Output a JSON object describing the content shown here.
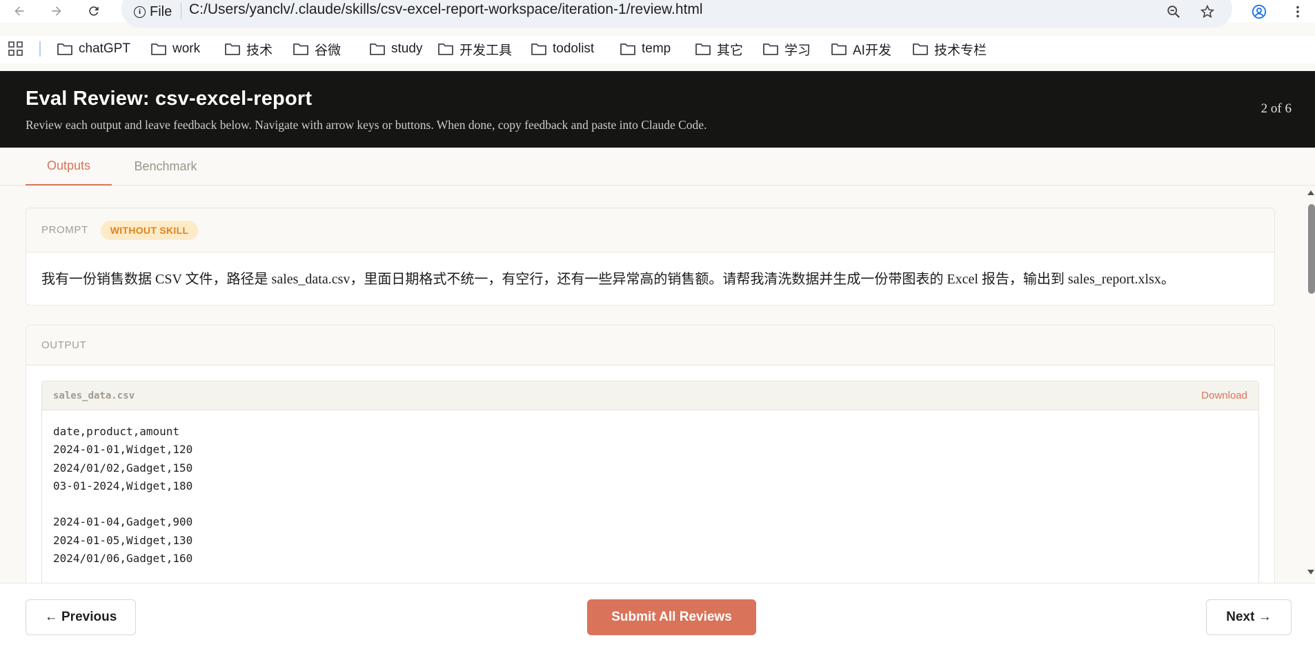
{
  "browser": {
    "file_label": "File",
    "url": "C:/Users/yanclv/.claude/skills/csv-excel-report-workspace/iteration-1/review.html",
    "bookmarks": [
      "chatGPT",
      "work",
      "技术",
      "谷微",
      "study",
      "开发工具",
      "todolist",
      "temp",
      "其它",
      "学习",
      "AI开发",
      "技术专栏"
    ]
  },
  "header": {
    "title": "Eval Review: csv-excel-report",
    "subtitle": "Review each output and leave feedback below. Navigate with arrow keys or buttons. When done, copy feedback and paste into Claude Code.",
    "counter": "2 of 6"
  },
  "tabs": [
    {
      "label": "Outputs",
      "active": true
    },
    {
      "label": "Benchmark",
      "active": false
    }
  ],
  "prompt": {
    "label": "PROMPT",
    "badge": "WITHOUT SKILL",
    "text": "我有一份销售数据 CSV 文件，路径是 sales_data.csv，里面日期格式不统一，有空行，还有一些异常高的销售额。请帮我清洗数据并生成一份带图表的 Excel 报告，输出到 sales_report.xlsx。"
  },
  "output": {
    "label": "OUTPUT",
    "file_name": "sales_data.csv",
    "download_label": "Download",
    "content": "date,product,amount\n2024-01-01,Widget,120\n2024/01/02,Gadget,150\n03-01-2024,Widget,180\n\n2024-01-04,Gadget,900\n2024-01-05,Widget,130\n2024/01/06,Gadget,160\n\n"
  },
  "footer": {
    "previous_label": "← Previous",
    "submit_label": "Submit All Reviews",
    "next_label": "Next →"
  },
  "colors": {
    "accent": "#d9735a",
    "header_bg": "#151514",
    "badge_bg": "#fdebc8",
    "badge_text": "#e2821c"
  }
}
